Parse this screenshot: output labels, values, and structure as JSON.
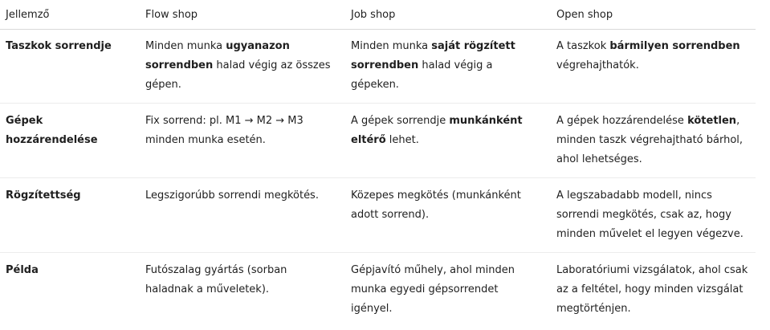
{
  "headers": [
    "Jellemző",
    "Flow shop",
    "Job shop",
    "Open shop"
  ],
  "rows": [
    {
      "label": "Taszkok sorrendje",
      "flow": [
        {
          "t": "Minden munka "
        },
        {
          "t": "ugyanazon sorrendben",
          "b": true
        },
        {
          "t": " halad végig az összes gépen."
        }
      ],
      "job": [
        {
          "t": "Minden munka "
        },
        {
          "t": "saját rögzített sorrendben",
          "b": true
        },
        {
          "t": " halad végig a gépeken."
        }
      ],
      "open": [
        {
          "t": "A taszkok "
        },
        {
          "t": "bármilyen sorrendben",
          "b": true
        },
        {
          "t": " végrehajthatók."
        }
      ]
    },
    {
      "label": "Gépek hozzárendelése",
      "flow": [
        {
          "t": "Fix sorrend: pl. M1 → M2 → M3 minden munka esetén."
        }
      ],
      "job": [
        {
          "t": "A gépek sorrendje "
        },
        {
          "t": "munkánként eltérő",
          "b": true
        },
        {
          "t": " lehet."
        }
      ],
      "open": [
        {
          "t": "A gépek hozzárendelése "
        },
        {
          "t": "kötetlen",
          "b": true
        },
        {
          "t": ", minden taszk végrehajtható bárhol, ahol lehetséges."
        }
      ]
    },
    {
      "label": "Rögzítettség",
      "flow": [
        {
          "t": "Legszigorúbb sorrendi megkötés."
        }
      ],
      "job": [
        {
          "t": "Közepes megkötés (munkánként adott sorrend)."
        }
      ],
      "open": [
        {
          "t": "A legszabadabb modell, nincs sorrendi megkötés, csak az, hogy minden művelet el legyen végezve."
        }
      ]
    },
    {
      "label": "Példa",
      "flow": [
        {
          "t": "Futószalag gyártás (sorban haladnak a műveletek)."
        }
      ],
      "job": [
        {
          "t": "Gépjavító műhely, ahol minden munka egyedi gépsorrendet igényel."
        }
      ],
      "open": [
        {
          "t": "Laboratóriumi vizsgálatok, ahol csak az a feltétel, hogy minden vizsgálat megtörténjen."
        }
      ]
    }
  ]
}
